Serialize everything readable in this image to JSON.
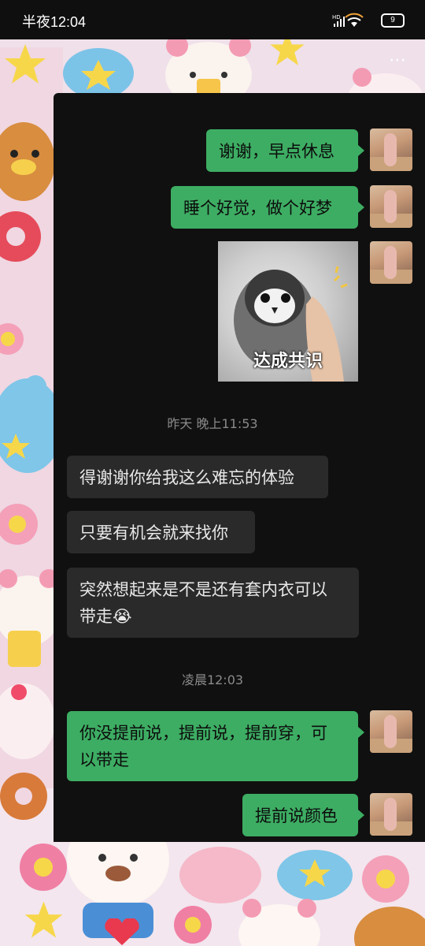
{
  "status_bar": {
    "time": "半夜12:04",
    "battery": "9",
    "network": "HD"
  },
  "header": {
    "more_icon": "⋯"
  },
  "messages": [
    {
      "side": "out",
      "text": "谢谢，早点休息"
    },
    {
      "side": "out",
      "text": "睡个好觉，做个好梦"
    },
    {
      "side": "out",
      "type": "image",
      "caption": "达成共识"
    },
    {
      "side": "in",
      "text": "得谢谢你给我这么难忘的体验"
    },
    {
      "side": "in",
      "text": "只要有机会就来找你"
    },
    {
      "side": "in",
      "text_line1": "突然想起来是不是还有套内衣可以",
      "text_line2": "带走",
      "emoji": "😭"
    },
    {
      "side": "out",
      "text_line1": "你没提前说，提前说，提前穿，可",
      "text_line2": "以带走"
    },
    {
      "side": "out",
      "text": "提前说颜色"
    }
  ],
  "timestamps": {
    "t1": "昨天 晚上11:53",
    "t2": "凌晨12:03"
  },
  "colors": {
    "outgoing_bubble": "#3dad63",
    "incoming_bubble": "#2a2a2a",
    "chat_bg": "#101010"
  }
}
